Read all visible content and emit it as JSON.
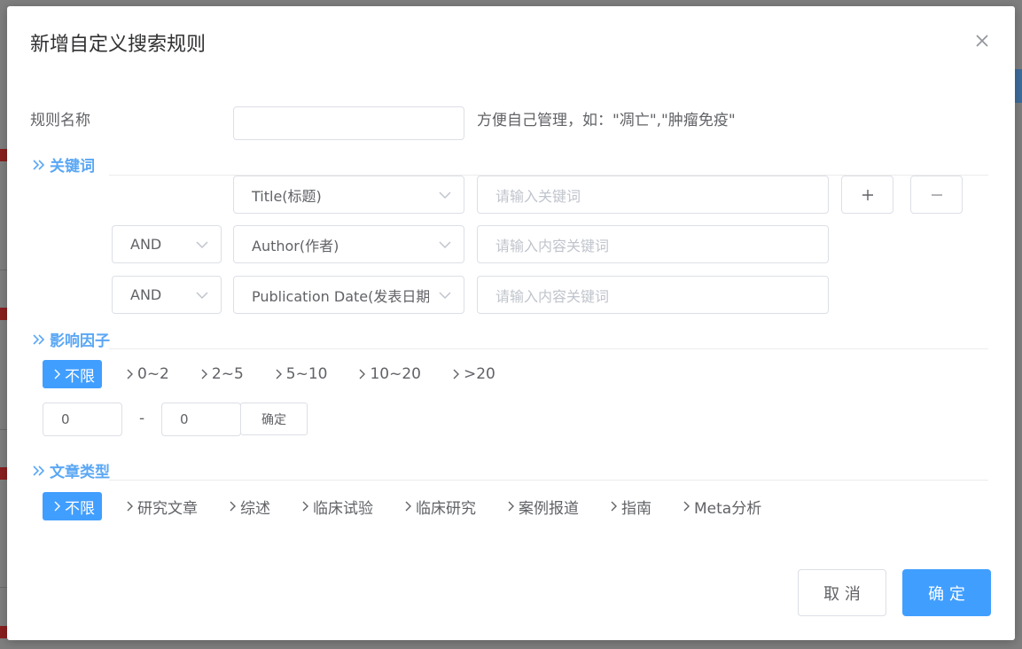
{
  "dialog": {
    "title": "新增自定义搜索规则",
    "rule_name_label": "规则名称",
    "rule_name_value": "",
    "rule_name_hint": "方便自己管理，如：\"凋亡\",\"肿瘤免疫\""
  },
  "keywords": {
    "section_label": "关键词",
    "rows": [
      {
        "operator": "",
        "field": "Title(标题)",
        "placeholder": "请输入关键词"
      },
      {
        "operator": "AND",
        "field": "Author(作者)",
        "placeholder": "请输入内容关键词"
      },
      {
        "operator": "AND",
        "field": "Publication Date(发表日期)",
        "placeholder": "请输入内容关键词"
      }
    ],
    "add_label": "+",
    "remove_label": "−"
  },
  "impact_factor": {
    "section_label": "影响因子",
    "options": [
      "不限",
      "0~2",
      "2~5",
      "5~10",
      "10~20",
      ">20"
    ],
    "selected_index": 0,
    "min_value": "0",
    "range_separator": "-",
    "max_value": "0",
    "confirm_label": "确定"
  },
  "article_type": {
    "section_label": "文章类型",
    "options": [
      "不限",
      "研究文章",
      "综述",
      "临床试验",
      "临床研究",
      "案例报道",
      "指南",
      "Meta分析"
    ],
    "selected_index": 0
  },
  "footer": {
    "cancel_label": "取 消",
    "ok_label": "确 定"
  },
  "colors": {
    "primary": "#409eff",
    "section_title": "#5aa7f4",
    "border": "#dcdfe6",
    "placeholder": "#c0c4cc"
  }
}
